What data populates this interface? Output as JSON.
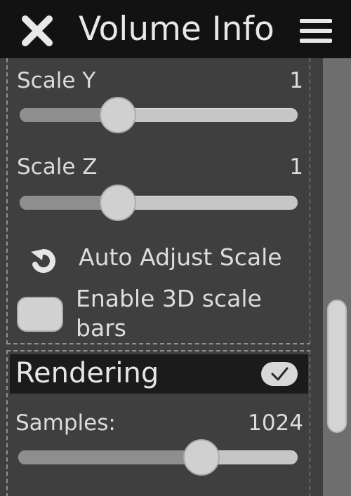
{
  "window": {
    "title": "Volume Info",
    "close_icon": "close-icon",
    "menu_icon": "hamburger-menu-icon"
  },
  "scale_y": {
    "label": "Scale Y",
    "value": "1",
    "level": 0.33
  },
  "scale_z": {
    "label": "Scale Z",
    "value": "1",
    "level": 0.33
  },
  "auto_adjust": {
    "label": "Auto Adjust Scale",
    "icon": "rotate-arrow-icon"
  },
  "scale_bars": {
    "label": "Enable 3D scale bars",
    "checked": false
  },
  "rendering": {
    "title": "Rendering",
    "enabled": true,
    "check_icon": "checkmark-icon",
    "samples_label": "Samples:",
    "samples_value": "1024",
    "samples_level": 0.68
  },
  "scrollbar": {
    "position": 0.8
  },
  "colors": {
    "titlebar": "#121212",
    "panel": "#3f3f3f",
    "text": "#dcdcdc",
    "slider_track": "#c6c6c6",
    "slider_fill": "#8e8e8e"
  }
}
